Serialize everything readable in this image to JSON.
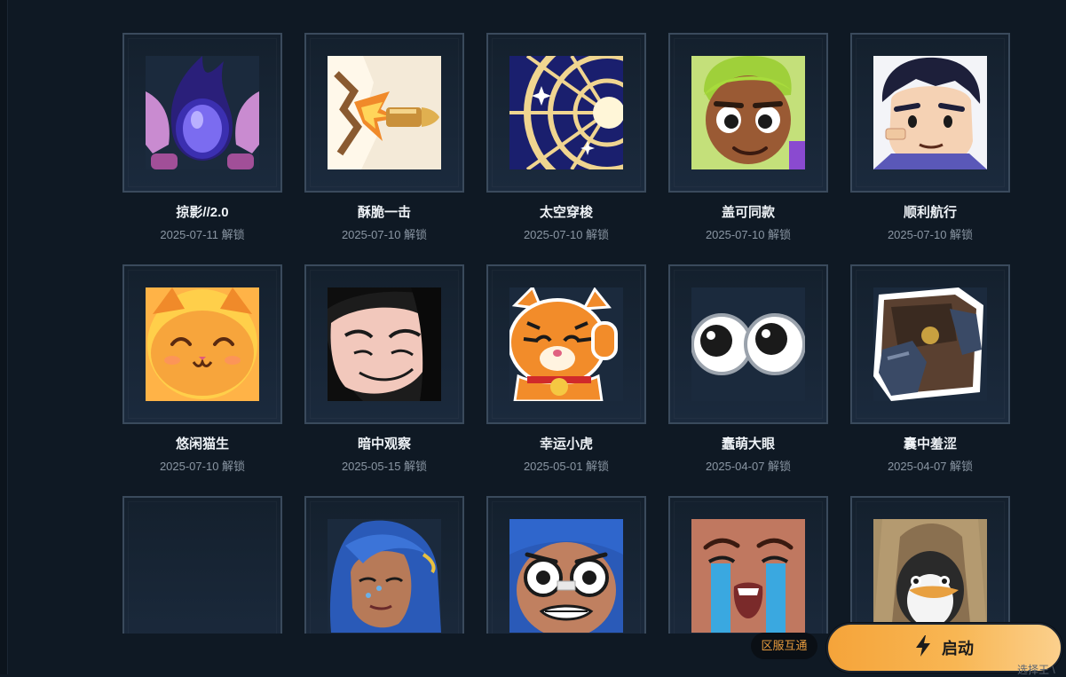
{
  "sprays": [
    {
      "name": "掠影//2.0",
      "date": "2025-07-11 解锁",
      "icon": "purple-flame-orb-icon"
    },
    {
      "name": "酥脆一击",
      "date": "2025-07-10 解锁",
      "icon": "bullet-icon"
    },
    {
      "name": "太空穿梭",
      "date": "2025-07-10 解锁",
      "icon": "space-portal-icon"
    },
    {
      "name": "盖可同款",
      "date": "2025-07-10 解锁",
      "icon": "green-hair-agent-icon"
    },
    {
      "name": "顺利航行",
      "date": "2025-07-10 解锁",
      "icon": "dark-hair-agent-icon"
    },
    {
      "name": "悠闲猫生",
      "date": "2025-07-10 解锁",
      "icon": "happy-cat-icon"
    },
    {
      "name": "暗中观察",
      "date": "2025-05-15 解锁",
      "icon": "peeking-face-icon"
    },
    {
      "name": "幸运小虎",
      "date": "2025-05-01 解锁",
      "icon": "lucky-tiger-icon"
    },
    {
      "name": "蠢萌大眼",
      "date": "2025-04-07 解锁",
      "icon": "googly-eyes-icon"
    },
    {
      "name": "囊中羞涩",
      "date": "2025-04-07 解锁",
      "icon": "empty-wallet-icon"
    },
    {
      "name": "",
      "date": "",
      "icon": "empty-slot"
    },
    {
      "name": "",
      "date": "",
      "icon": "blue-hair-agent-icon"
    },
    {
      "name": "",
      "date": "",
      "icon": "shocked-agent-icon"
    },
    {
      "name": "",
      "date": "",
      "icon": "crying-agent-icon"
    },
    {
      "name": "",
      "date": "",
      "icon": "penguin-hood-icon"
    }
  ],
  "footer": {
    "region_badge": "区服互通",
    "launch_label": "启动",
    "corner_text": "选择王 \\"
  },
  "colors": {
    "background": "#0f1924",
    "tile_border": "#3a4a5c",
    "launch_gradient_start": "#f5a43a",
    "launch_gradient_end": "#fbd08d",
    "badge_text": "#e79b3d"
  }
}
